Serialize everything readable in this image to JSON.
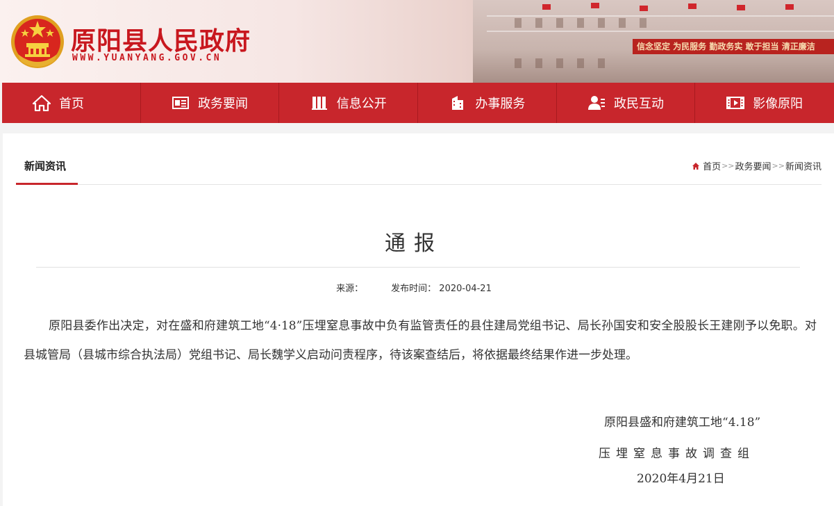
{
  "site": {
    "title": "原阳县人民政府",
    "domain": "WWW.YUANYANG.GOV.CN",
    "banner_slogan": "信念坚定  为民服务  勤政务实  敢于担当  清正廉洁",
    "brand_color": "#c8262c"
  },
  "nav": {
    "items": [
      {
        "label": "首页",
        "icon": "home-icon"
      },
      {
        "label": "政务要闻",
        "icon": "newspaper-icon"
      },
      {
        "label": "信息公开",
        "icon": "books-icon"
      },
      {
        "label": "办事服务",
        "icon": "building-icon"
      },
      {
        "label": "政民互动",
        "icon": "user-chat-icon"
      },
      {
        "label": "影像原阳",
        "icon": "film-icon"
      }
    ]
  },
  "section": {
    "tab_label": "新闻资讯",
    "breadcrumb": [
      "首页",
      "政务要闻",
      "新闻资讯"
    ]
  },
  "article": {
    "title": "通报",
    "source_label": "来源：",
    "date_label": "发布时间：",
    "date": "2020-04-21",
    "body": "原阳县委作出决定，对在盛和府建筑工地“4·18”压埋窒息事故中负有监管责任的县住建局党组书记、局长孙国安和安全股股长王建刚予以免职。对县城管局（县城市综合执法局）党组书记、局长魏学义启动问责程序，待该案查结后，将依据最终结果作进一步处理。",
    "signature_line1": "原阳县盛和府建筑工地“4.18”",
    "signature_line2": "压埋窒息事故调查组",
    "signature_date": "2020年4月21日"
  }
}
